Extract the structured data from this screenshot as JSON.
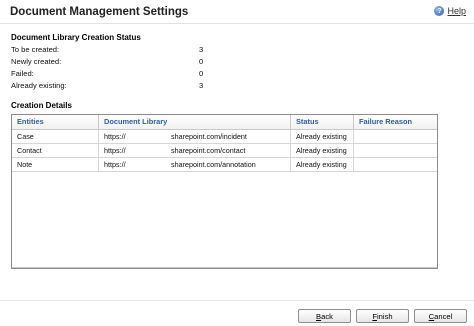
{
  "header": {
    "title": "Document Management Settings",
    "help_label": "Help",
    "help_icon": "help-icon"
  },
  "status_section": {
    "heading": "Document Library Creation Status",
    "rows": [
      {
        "label": "To be created:",
        "value": "3"
      },
      {
        "label": "Newly created:",
        "value": "0"
      },
      {
        "label": "Failed:",
        "value": "0"
      },
      {
        "label": "Already existing:",
        "value": "3"
      }
    ]
  },
  "details_section": {
    "heading": "Creation Details",
    "columns": [
      "Entities",
      "Document Library",
      "Status",
      "Failure Reason"
    ],
    "rows": [
      {
        "entity": "Case",
        "library_prefix": "https://",
        "library_suffix": "sharepoint.com/incident",
        "status": "Already existing",
        "reason": ""
      },
      {
        "entity": "Contact",
        "library_prefix": "https://",
        "library_suffix": "sharepoint.com/contact",
        "status": "Already existing",
        "reason": ""
      },
      {
        "entity": "Note",
        "library_prefix": "https://",
        "library_suffix": "sharepoint.com/annotation",
        "status": "Already existing",
        "reason": ""
      }
    ]
  },
  "footer": {
    "back": {
      "hotkey": "B",
      "rest": "ack"
    },
    "finish": {
      "hotkey": "F",
      "rest": "inish"
    },
    "cancel": {
      "hotkey": "C",
      "rest": "ancel"
    }
  }
}
